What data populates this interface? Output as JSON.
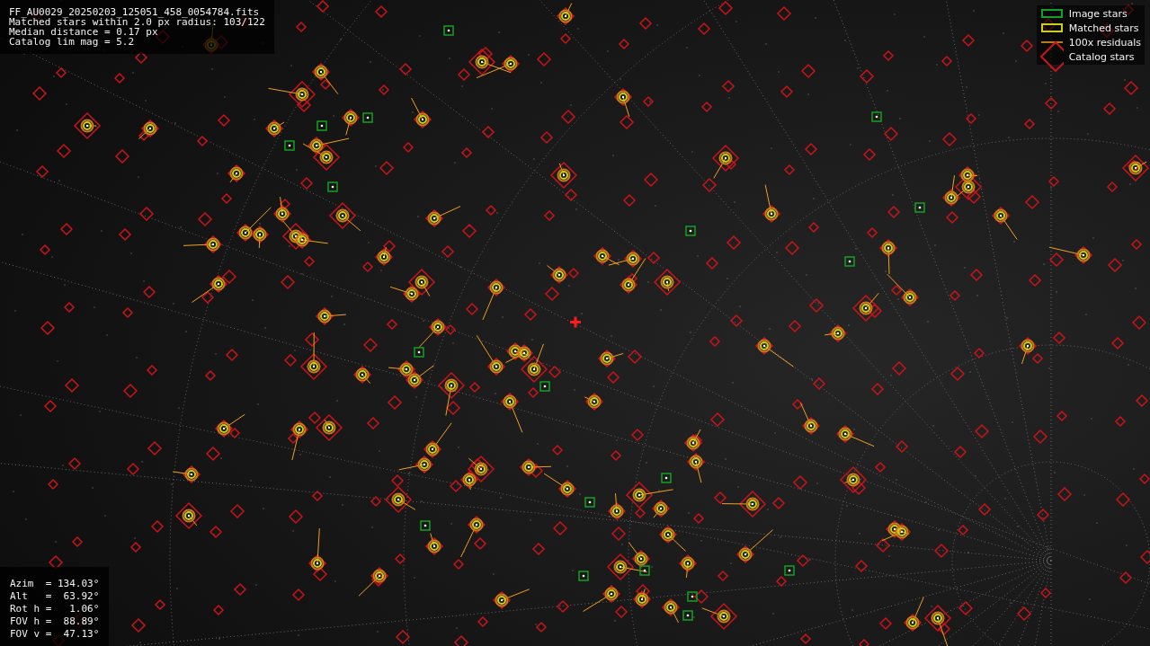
{
  "info_lines": [
    "FF_AU0029_20250203_125051_458_0054784.fits",
    "Matched stars within 2.0 px radius: 103/122",
    "Median distance = 0.17 px",
    "Catalog lim mag = 5.2"
  ],
  "legend": [
    {
      "kind": "image",
      "label": "Image stars"
    },
    {
      "kind": "matched",
      "label": "Matched stars"
    },
    {
      "kind": "residual",
      "label": "100x residuals"
    },
    {
      "kind": "catalog",
      "label": "Catalog stars"
    }
  ],
  "pointing": [
    "Azim  = 134.03°",
    "Alt   =  63.92°",
    "Rot h =   1.06°",
    "FOV h =  88.89°",
    "FOV v =  47.13°"
  ]
}
